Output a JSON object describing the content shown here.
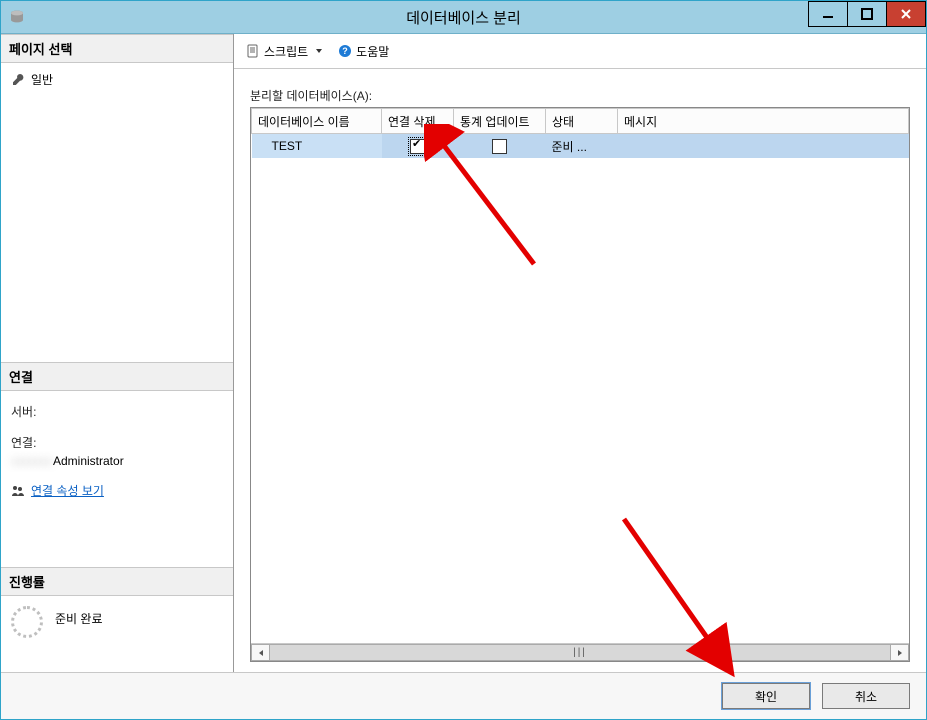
{
  "titlebar": {
    "title": "데이터베이스 분리"
  },
  "winbtns": {
    "min_tip": "최소화",
    "max_tip": "최대화",
    "close_tip": "닫기"
  },
  "left": {
    "page_select_header": "페이지 선택",
    "page_general": "일반",
    "conn_header": "연결",
    "server_label": "서버:",
    "server_value": "",
    "conn_label": "연결:",
    "conn_value": "Administrator",
    "view_conn_props": "연결 속성 보기",
    "progress_header": "진행률",
    "progress_status": "준비 완료"
  },
  "toolbar": {
    "script_label": "스크립트",
    "help_label": "도움말"
  },
  "main": {
    "section_label": "분리할 데이터베이스(A):",
    "columns": {
      "db_name": "데이터베이스 이름",
      "drop_conn": "연결 삭제",
      "update_stats": "통계 업데이트",
      "status": "상태",
      "message": "메시지"
    },
    "rows": [
      {
        "db_name": "TEST",
        "drop_conn_checked": true,
        "update_stats_checked": false,
        "status": "준비 ...",
        "message": ""
      }
    ]
  },
  "footer": {
    "ok": "확인",
    "cancel": "취소"
  }
}
